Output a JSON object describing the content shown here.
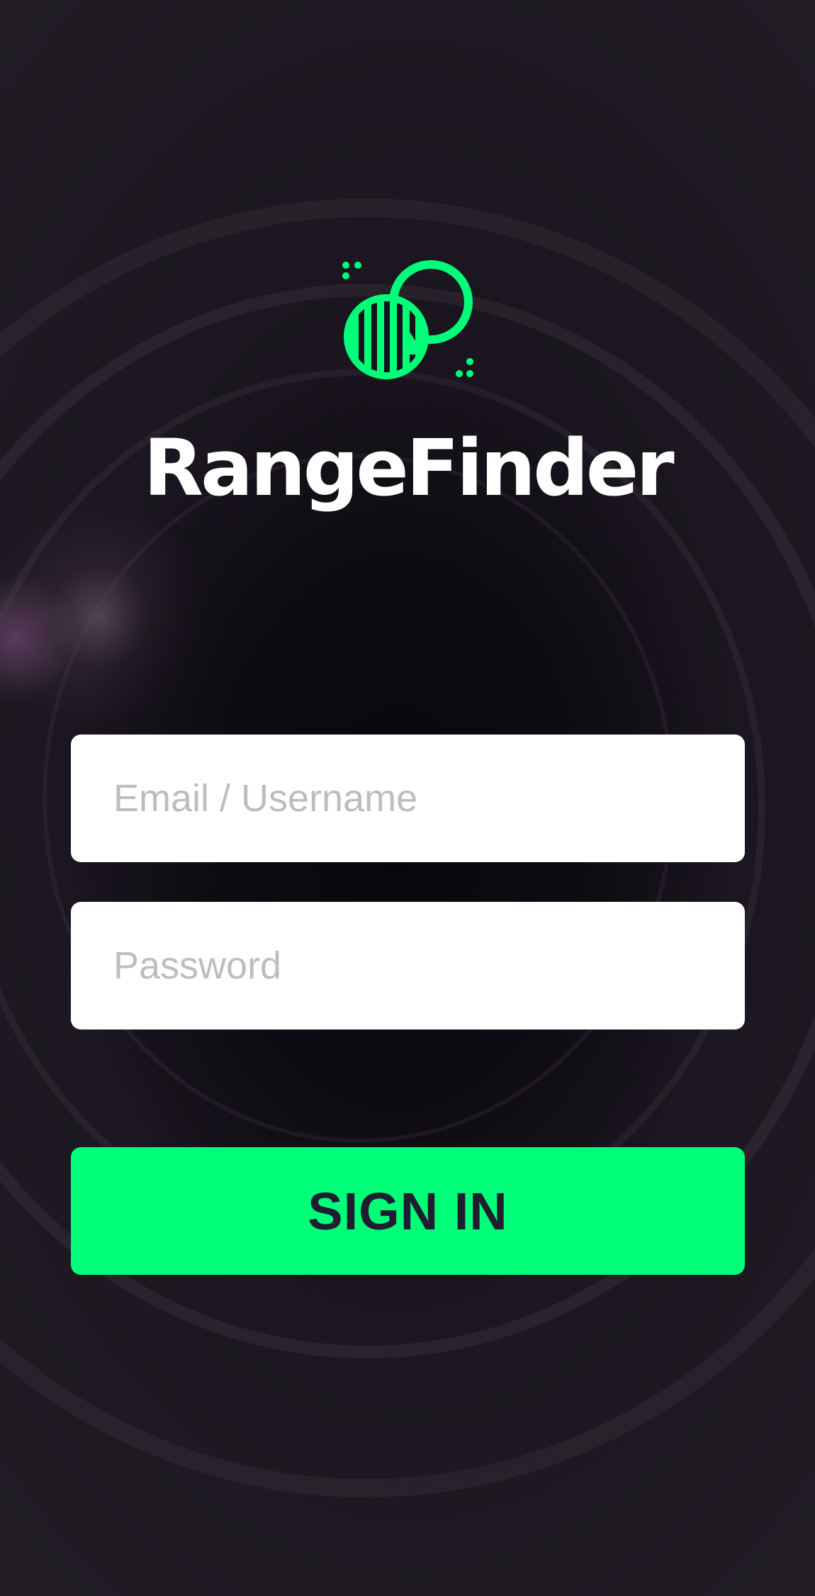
{
  "app": {
    "name": "RangeFinder",
    "accent_color": "#00ff78"
  },
  "login": {
    "username_placeholder": "Email / Username",
    "username_value": "",
    "password_placeholder": "Password",
    "password_value": "",
    "sign_in_label": "SIGN IN"
  },
  "icons": {
    "logo": "rangefinder-lens-logo-icon"
  }
}
